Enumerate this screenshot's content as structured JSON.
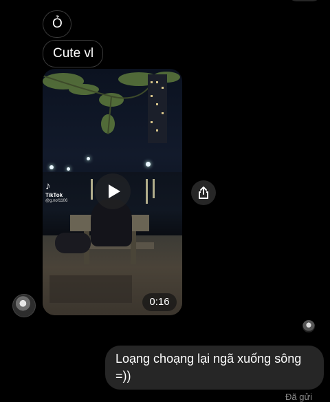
{
  "messages": [
    {
      "text": "Ỏ"
    },
    {
      "text": "Cute vl"
    }
  ],
  "video": {
    "duration": "0:16",
    "tiktok_label": "TikTok",
    "tiktok_handle": "@g.nof1106"
  },
  "outgoing": {
    "text": "Loạng choạng lại ngã xuống sông =))"
  },
  "status": "Đã gửi",
  "colors": {
    "background": "#000000",
    "incoming_border": "#3a3a3a",
    "outgoing_bubble": "#262626",
    "share_button": "#262626"
  },
  "icons": {
    "play": "play-icon",
    "share": "share-icon",
    "tiktok": "tiktok-logo-icon"
  }
}
